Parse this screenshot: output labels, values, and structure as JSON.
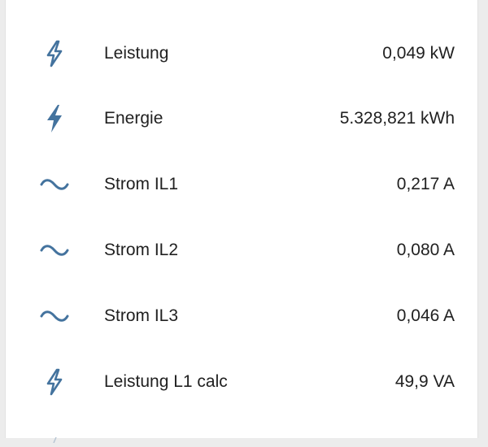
{
  "colors": {
    "icon": "#44739e",
    "text": "#212121",
    "card_background": "#ffffff",
    "page_background": "#ececec"
  },
  "entities": [
    {
      "icon": "flash-outline-icon",
      "label": "Leistung",
      "value": "0,049 kW"
    },
    {
      "icon": "flash-icon",
      "label": "Energie",
      "value": "5.328,821 kWh"
    },
    {
      "icon": "current-ac-icon",
      "label": "Strom IL1",
      "value": "0,217 A"
    },
    {
      "icon": "current-ac-icon",
      "label": "Strom IL2",
      "value": "0,080 A"
    },
    {
      "icon": "current-ac-icon",
      "label": "Strom IL3",
      "value": "0,046 A"
    },
    {
      "icon": "flash-outline-icon",
      "label": "Leistung L1 calc",
      "value": "49,9 VA"
    }
  ]
}
